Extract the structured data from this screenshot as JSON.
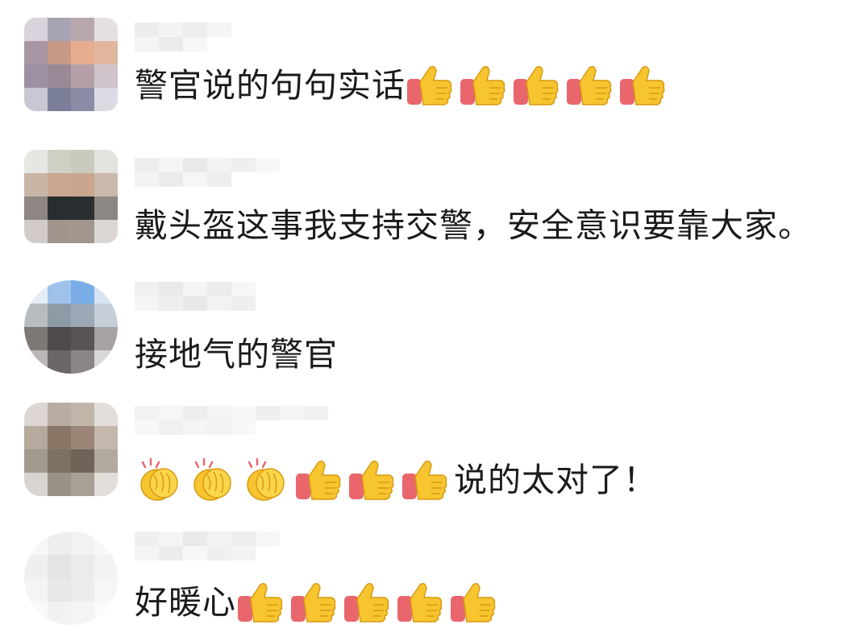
{
  "comments": [
    {
      "text": "警官说的句句实话",
      "emojis_after": [
        "thumbs-up",
        "thumbs-up",
        "thumbs-up",
        "thumbs-up",
        "thumbs-up"
      ]
    },
    {
      "text": "戴头盔这事我支持交警，安全意识要靠大家。"
    },
    {
      "text": "接地气的警官"
    },
    {
      "emojis_before": [
        "clapping-hands",
        "clapping-hands",
        "clapping-hands",
        "thumbs-up",
        "thumbs-up",
        "thumbs-up"
      ],
      "text": "说的太对了！"
    },
    {
      "text": "好暖心",
      "emojis_after": [
        "thumbs-up",
        "thumbs-up",
        "thumbs-up",
        "thumbs-up",
        "thumbs-up"
      ]
    }
  ],
  "colors": {
    "background": "#ffffff",
    "text": "#1a1a1a",
    "thumb_yellow": "#f7c52f",
    "cuff_pink": "#e9666d"
  }
}
